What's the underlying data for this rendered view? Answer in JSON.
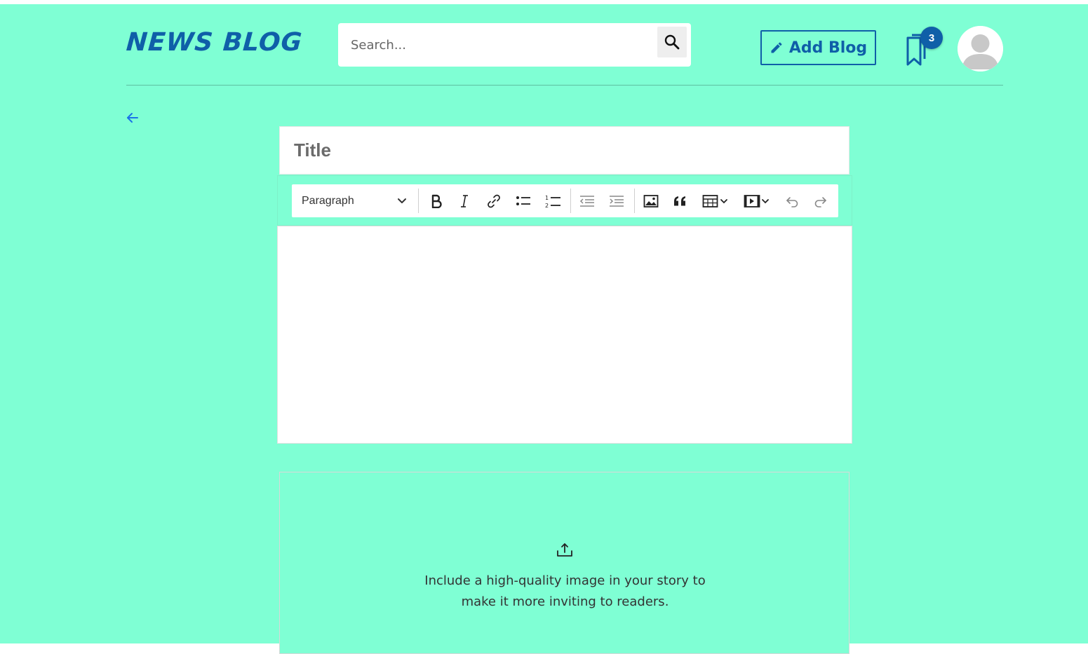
{
  "header": {
    "logo": "NEWS BLOG",
    "search": {
      "placeholder": "Search..."
    },
    "add_blog_label": "Add Blog",
    "bookmark_count": "3"
  },
  "editor": {
    "title_placeholder": "Title",
    "toolbar": {
      "block_format": "Paragraph",
      "buttons": [
        "bold",
        "italic",
        "link",
        "bulleted-list",
        "numbered-list",
        "outdent",
        "indent",
        "insert-image",
        "block-quote",
        "insert-table",
        "insert-media",
        "undo",
        "redo"
      ]
    },
    "body_text": ""
  },
  "upload": {
    "line1": "Include a high-quality image in your story to",
    "line2": "make it more inviting to readers."
  },
  "colors": {
    "background": "#7fffd4",
    "accent": "#0f5fa8"
  }
}
